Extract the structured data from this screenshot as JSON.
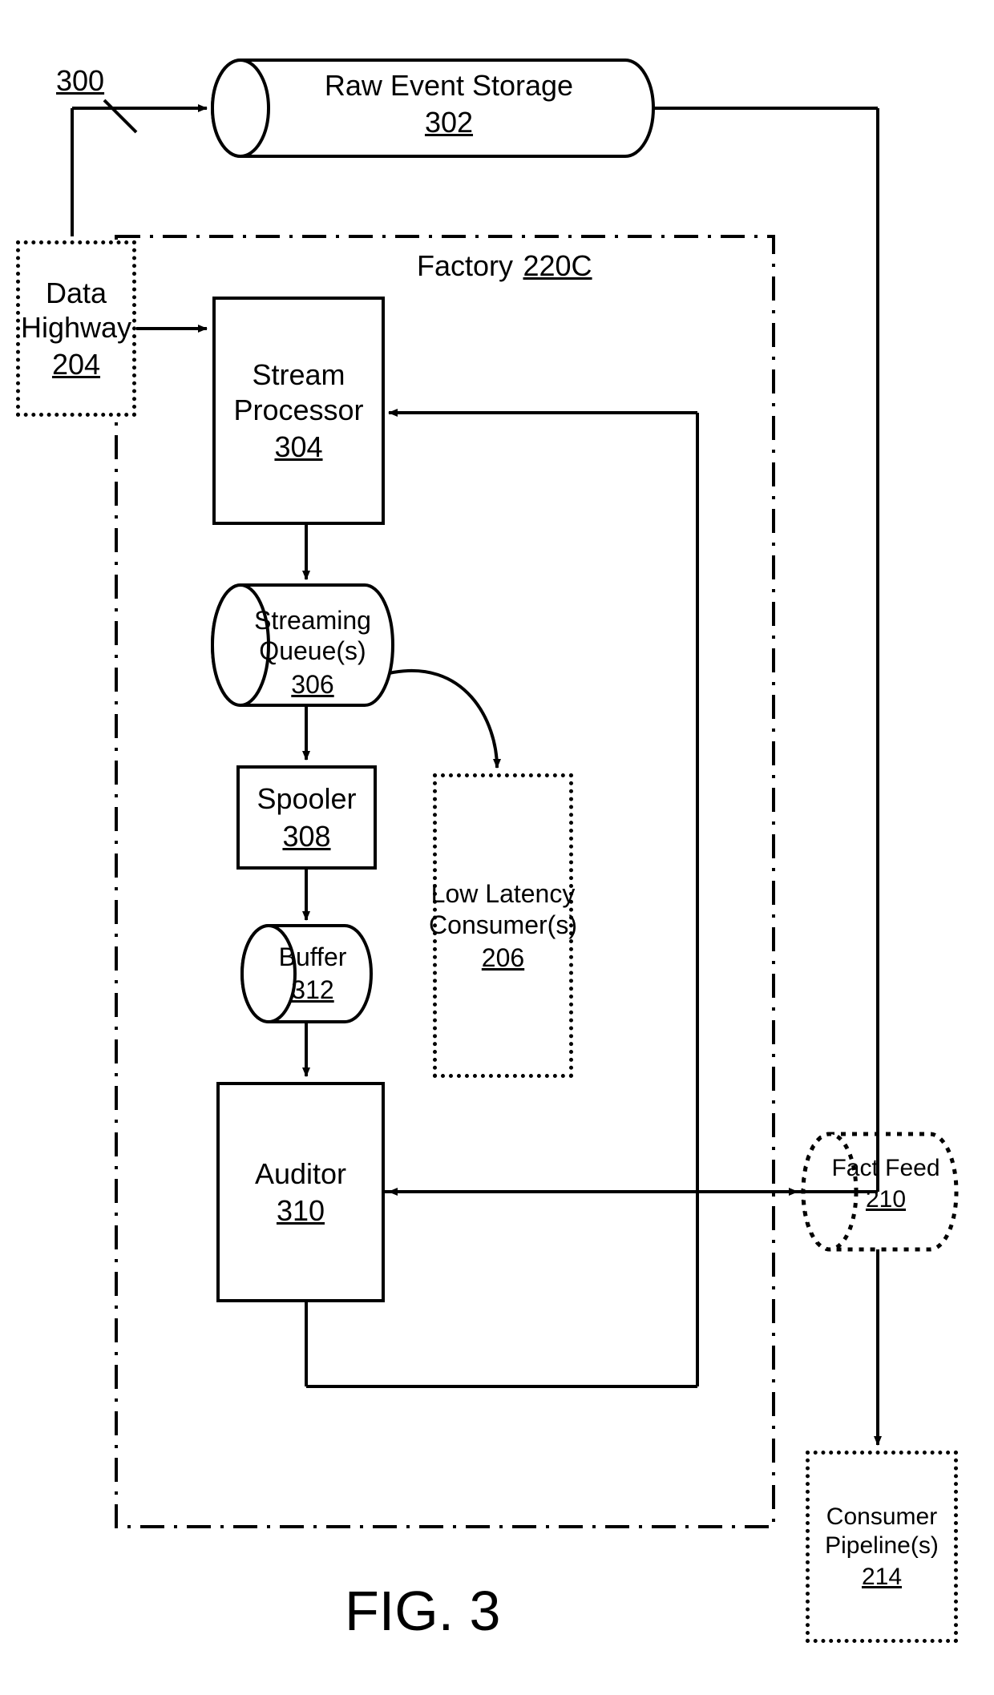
{
  "figure_ref": "300",
  "raw_event_storage": {
    "label": "Raw Event Storage",
    "ref": "302"
  },
  "data_highway": {
    "label": "Data Highway",
    "ref": "204"
  },
  "factory": {
    "label": "Factory",
    "ref": "220C"
  },
  "stream_processor": {
    "label": "Stream Processor",
    "ref": "304"
  },
  "streaming_queues": {
    "label": "Streaming Queue(s)",
    "ref": "306"
  },
  "spooler": {
    "label": "Spooler",
    "ref": "308"
  },
  "buffer": {
    "label": "Buffer",
    "ref": "312"
  },
  "auditor": {
    "label": "Auditor",
    "ref": "310"
  },
  "low_latency_consumers": {
    "label": "Low Latency Consumer(s)",
    "ref": "206"
  },
  "fact_feed": {
    "label": "Fact Feed",
    "ref": "210"
  },
  "consumer_pipelines": {
    "label": "Consumer Pipeline(s)",
    "ref": "214"
  },
  "figure_caption": "FIG. 3"
}
